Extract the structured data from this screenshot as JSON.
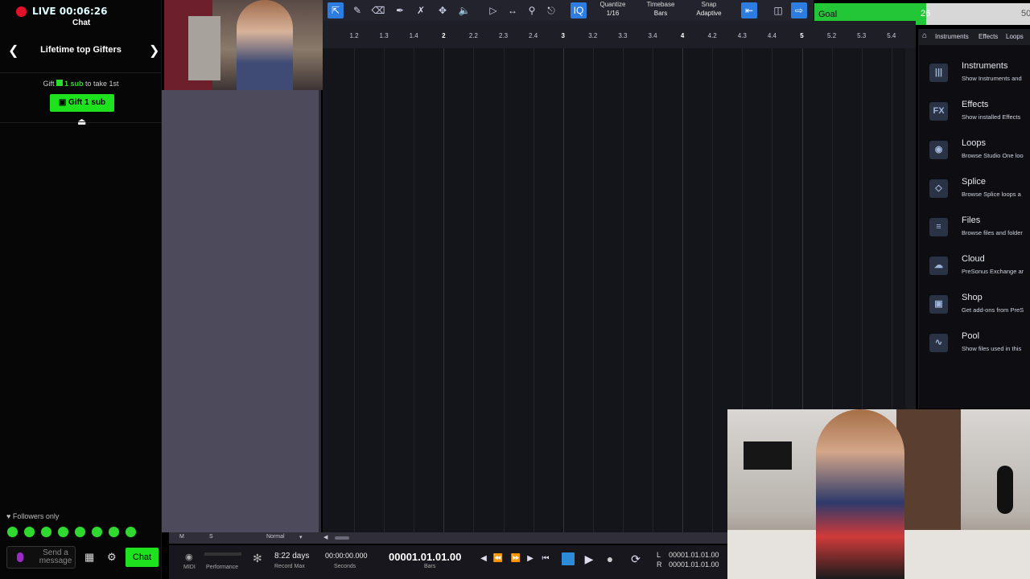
{
  "stream": {
    "live_label": "LIVE 00:06:26",
    "chat_label": "Chat"
  },
  "gifters": {
    "title": "Lifetime top Gifters",
    "hint_prefix": "Gift",
    "hint_bold": "1 sub",
    "hint_suffix": "to take 1st",
    "gift_button": "Gift 1 sub"
  },
  "chat": {
    "followers_only": "Followers only",
    "input_placeholder": "Send a message",
    "chat_button": "Chat"
  },
  "toolbar": {
    "quantize_label": "Quantize",
    "quantize_value": "1/16",
    "timebase_label": "Timebase",
    "timebase_value": "Bars",
    "snap_label": "Snap",
    "snap_value": "Adaptive"
  },
  "goal": {
    "label": "Goal",
    "current": "26",
    "target": "50",
    "progress_fraction": 0.52,
    "fill_color": "#22c637"
  },
  "ruler": {
    "ticks": [
      "1.2",
      "1.3",
      "1.4",
      "2",
      "2.2",
      "2.3",
      "2.4",
      "3",
      "3.2",
      "3.3",
      "3.4",
      "4",
      "4.2",
      "4.3",
      "4.4",
      "5",
      "5.2",
      "5.3",
      "5.4"
    ],
    "major_ticks": [
      "2",
      "3",
      "4",
      "5"
    ]
  },
  "browser": {
    "tabs": [
      "Instruments",
      "Effects",
      "Loops"
    ],
    "items": [
      {
        "name": "Instruments",
        "desc": "Show Instruments and",
        "icon": "piano-icon"
      },
      {
        "name": "Effects",
        "desc": "Show installed Effects",
        "icon": "fx-icon"
      },
      {
        "name": "Loops",
        "desc": "Browse Studio One loo",
        "icon": "loops-icon"
      },
      {
        "name": "Splice",
        "desc": "Browse Splice loops a",
        "icon": "splice-icon"
      },
      {
        "name": "Files",
        "desc": "Browse files and folder",
        "icon": "files-icon"
      },
      {
        "name": "Cloud",
        "desc": "PreSonus Exchange ar",
        "icon": "cloud-icon"
      },
      {
        "name": "Shop",
        "desc": "Get add-ons from PreS",
        "icon": "shop-icon"
      },
      {
        "name": "Pool",
        "desc": "Show files used in this",
        "icon": "pool-icon"
      }
    ]
  },
  "track_footer": {
    "m": "M",
    "s": "S",
    "mode": "Normal"
  },
  "transport": {
    "midi": "MIDI",
    "performance": "Performance",
    "record_max_value": "8:22 days",
    "record_max_label": "Record Max",
    "seconds_value": "00:00:00.000",
    "seconds_label": "Seconds",
    "bars_value": "00001.01.01.00",
    "bars_label": "Bars",
    "loop_l": "00001.01.01.00",
    "loop_r": "00001.01.01.00",
    "l_label": "L",
    "r_label": "R"
  }
}
